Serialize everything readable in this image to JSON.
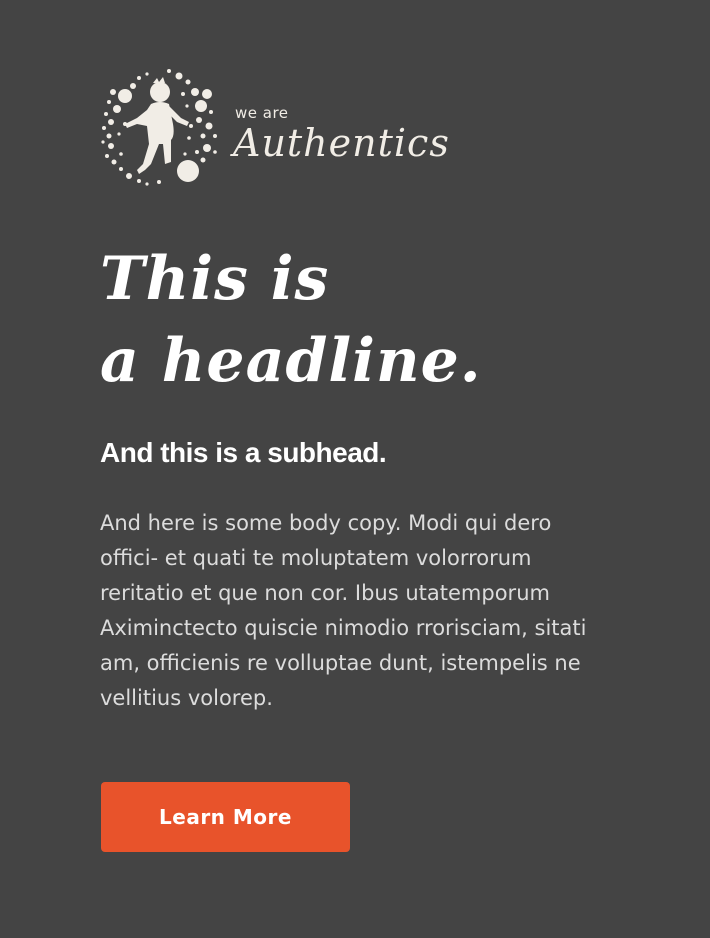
{
  "brand": {
    "tagline_small": "we are",
    "name": "Authentics"
  },
  "hero": {
    "headline_line1": "This is",
    "headline_line2": "a headline.",
    "subhead": "And this is a subhead.",
    "body": "And here is some body copy. Modi qui dero offici- et quati te moluptatem volorrorum reritatio et que non cor. Ibus utatemporum Aximinctecto quiscie nimodio rrorisciam, sitati am, officienis re volluptae dunt, istempelis ne vellitius volorep."
  },
  "cta": {
    "label": "Learn More"
  },
  "colors": {
    "background": "#444444",
    "accent": "#e8532b",
    "text_primary": "#ffffff",
    "text_body": "#dcdcdc",
    "logo_cream": "#f1ede6"
  },
  "icons": {
    "logo_mark": "child-with-ball-dotted-circle-logo"
  }
}
